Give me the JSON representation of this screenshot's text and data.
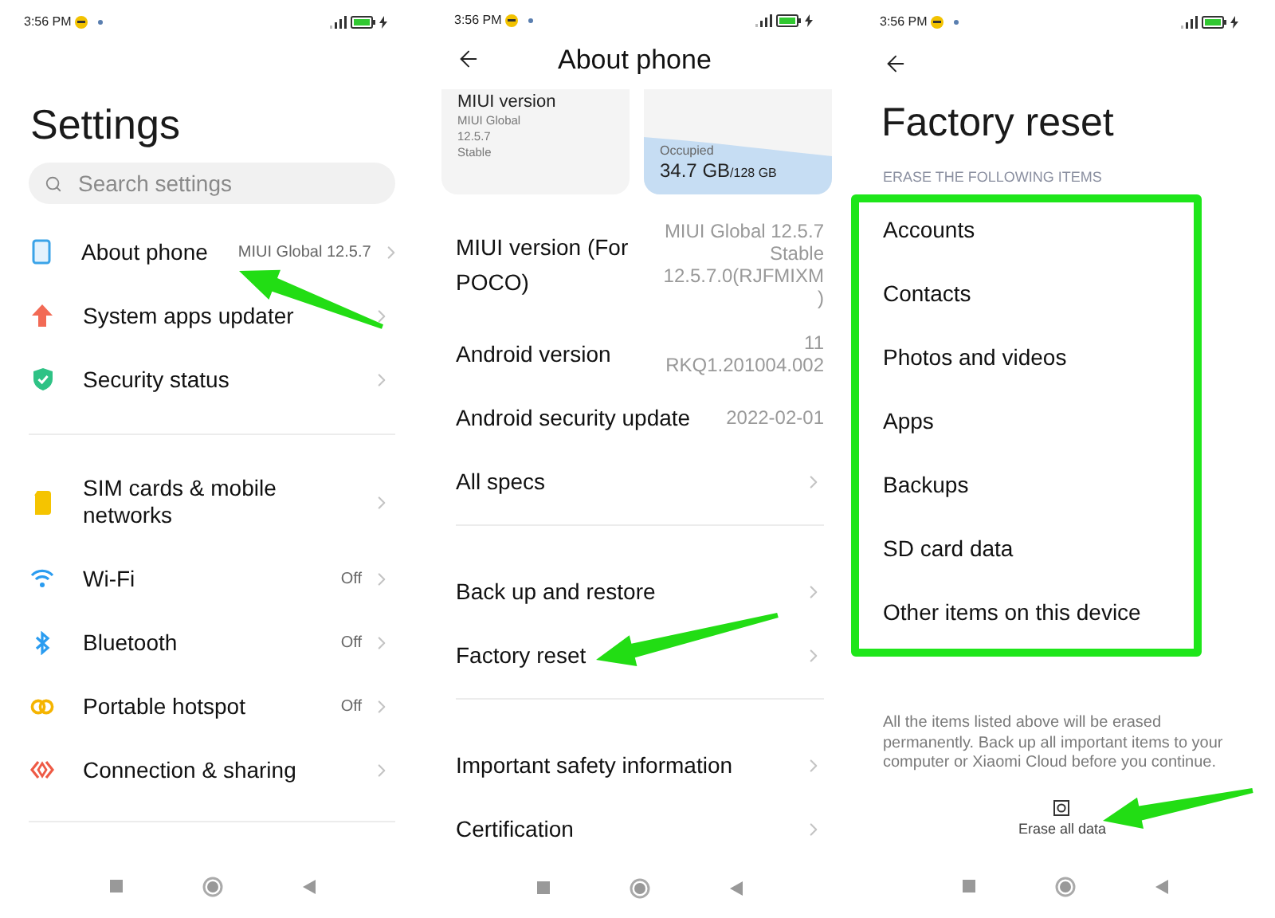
{
  "settings_screen": {
    "status_bar": {
      "time": "3:56 PM"
    },
    "title": "Settings",
    "search": {
      "placeholder": "Search settings"
    },
    "groups": [
      [
        {
          "label": "About phone",
          "value": "MIUI Global 12.5.7"
        },
        {
          "label": "System apps updater"
        },
        {
          "label": "Security status"
        }
      ],
      [
        {
          "label": "SIM cards & mobile networks"
        },
        {
          "label": "Wi-Fi",
          "value": "Off"
        },
        {
          "label": "Bluetooth",
          "value": "Off"
        },
        {
          "label": "Portable hotspot",
          "value": "Off"
        },
        {
          "label": "Connection & sharing"
        }
      ]
    ]
  },
  "about_phone_screen": {
    "status_bar": {
      "time": "3:56 PM"
    },
    "title": "About phone",
    "version_card": {
      "title": "MIUI version",
      "lines": [
        "MIUI Global",
        "12.5.7",
        "Stable"
      ]
    },
    "storage_card": {
      "label": "Occupied",
      "used": "34.7 GB",
      "total": "/128 GB"
    },
    "groups": [
      [
        {
          "label": "MIUI version (For POCO)",
          "value_lines": [
            "MIUI Global 12.5.7",
            "Stable",
            "12.5.7.0(RJFMIXM",
            ")"
          ]
        },
        {
          "label": "Android version",
          "value_lines": [
            "11",
            "RKQ1.201004.002"
          ]
        },
        {
          "label": "Android security update",
          "value_lines": [
            "2022-02-01"
          ]
        },
        {
          "label": "All specs"
        }
      ],
      [
        {
          "label": "Back up and restore"
        },
        {
          "label": "Factory reset"
        }
      ],
      [
        {
          "label": "Important safety information"
        },
        {
          "label": "Certification"
        }
      ]
    ]
  },
  "factory_reset_screen": {
    "status_bar": {
      "time": "3:56 PM"
    },
    "title": "Factory reset",
    "section_header": "ERASE THE FOLLOWING ITEMS",
    "items": [
      "Accounts",
      "Contacts",
      "Photos and videos",
      "Apps",
      "Backups",
      "SD card data",
      "Other items on this device"
    ],
    "notice": "All the items listed above will be erased permanently. Back up all important items to your computer or Xiaomi Cloud before you continue.",
    "action": {
      "label": "Erase all data"
    }
  }
}
